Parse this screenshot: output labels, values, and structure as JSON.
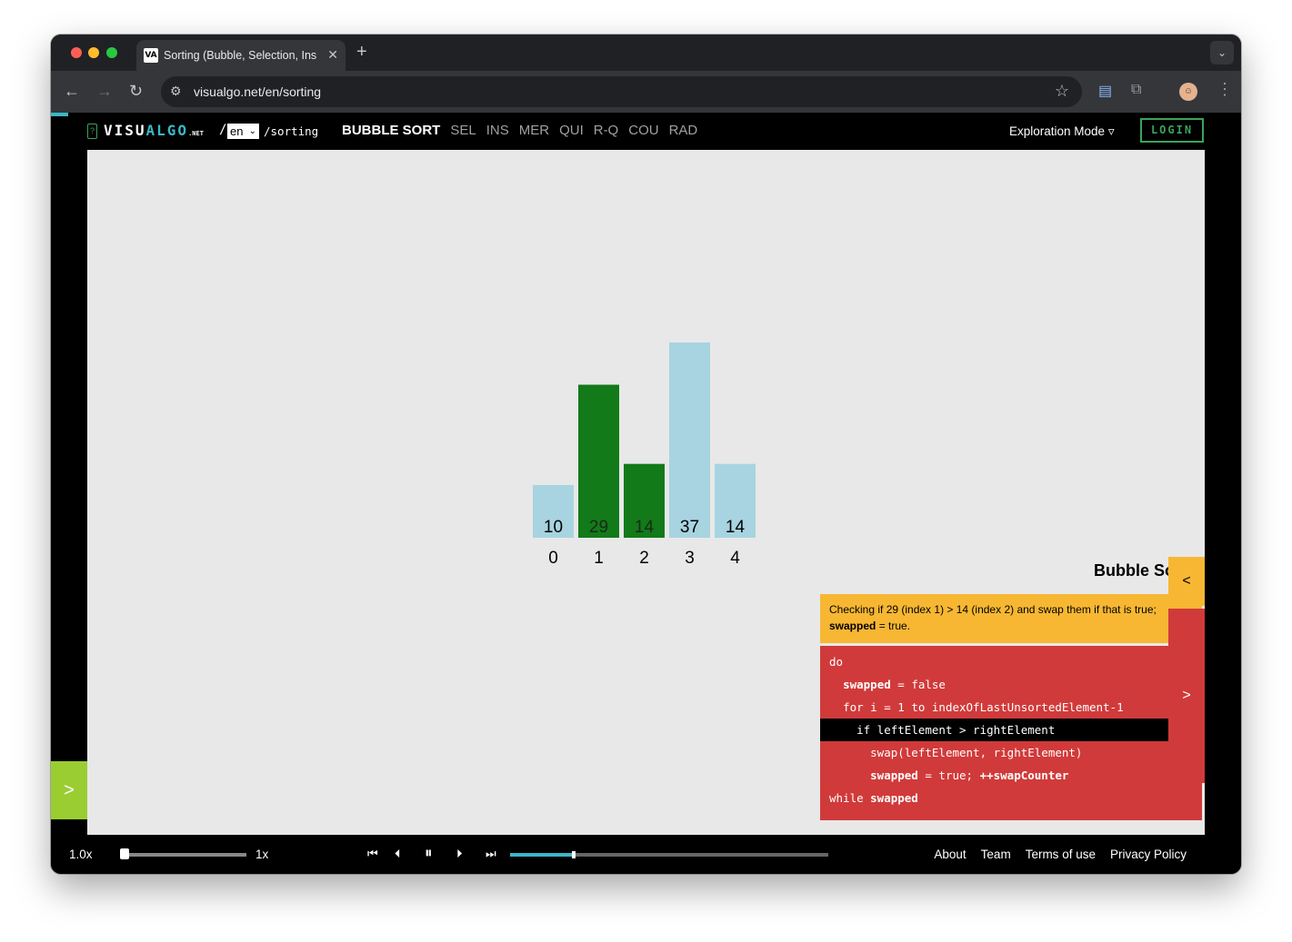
{
  "browser": {
    "tab_title": "Sorting (Bubble, Selection, Insertion, Merge, Quick, Counting, Radix) - VisuAlgo",
    "tab_favicon": "VA",
    "tab_close": "✕",
    "new_tab": "+",
    "tab_list": "⌄",
    "url": "visualgo.net/en/sorting",
    "icons": {
      "back": "←",
      "forward": "→",
      "reload": "↻",
      "site_settings": "⚙",
      "bookmark": "☆",
      "docs": "▤",
      "extensions": "⧉",
      "profile": "☺",
      "menu": "⋮"
    }
  },
  "site": {
    "help": "?",
    "logo": {
      "visu": "VISU",
      "algo": "ALGO",
      "net": ".NET"
    },
    "slash": "/",
    "language": "en",
    "language_caret": "⌄",
    "path": "/sorting",
    "algo_tabs": [
      "BUBBLE SORT",
      "SEL",
      "INS",
      "MER",
      "QUI",
      "R-Q",
      "COU",
      "RAD"
    ],
    "active_tab": "BUBBLE SORT",
    "mode": "Exploration Mode",
    "mode_caret": "▿",
    "login": "LOGIN"
  },
  "chart_data": {
    "type": "bar",
    "categories": [
      "0",
      "1",
      "2",
      "3",
      "4"
    ],
    "values": [
      10,
      29,
      14,
      37,
      14
    ],
    "highlighted_indices": [
      1,
      2
    ],
    "colors": {
      "default": "#a7d4e0",
      "compared": "#127a19"
    },
    "title": "",
    "xlabel": "",
    "ylabel": ""
  },
  "panel": {
    "title": "Bubble Sort",
    "status_pre": "Checking if 29 (index 1) > 14 (index 2) and swap them if that is true; ",
    "status_bold": "swapped",
    "status_post": " = true.",
    "status_toggle": "<",
    "code_toggle": ">",
    "active_line": 3,
    "code": [
      {
        "indent": "",
        "segments": [
          {
            "text": "do",
            "bold": false
          }
        ]
      },
      {
        "indent": "  ",
        "segments": [
          {
            "text": "swapped",
            "bold": true
          },
          {
            "text": " = false",
            "bold": false
          }
        ]
      },
      {
        "indent": "  ",
        "segments": [
          {
            "text": "for i = 1 to indexOfLastUnsortedElement-1",
            "bold": false
          }
        ]
      },
      {
        "indent": "    ",
        "segments": [
          {
            "text": "if leftElement > rightElement",
            "bold": false
          }
        ]
      },
      {
        "indent": "      ",
        "segments": [
          {
            "text": "swap(leftElement, rightElement)",
            "bold": false
          }
        ]
      },
      {
        "indent": "      ",
        "segments": [
          {
            "text": "swapped",
            "bold": true
          },
          {
            "text": " = true; ",
            "bold": false
          },
          {
            "text": "++swapCounter",
            "bold": true
          }
        ]
      },
      {
        "indent": "",
        "segments": [
          {
            "text": "while ",
            "bold": false
          },
          {
            "text": "swapped",
            "bold": true
          }
        ]
      }
    ]
  },
  "left_toggle": ">",
  "controls": {
    "speed_label": "1.0x",
    "speed_right": "1x",
    "speed_fraction": 0.0,
    "progress_fraction": 0.2,
    "icons": {
      "first": "⏮",
      "prev": "⏴",
      "pause": "⏸",
      "next": "⏵",
      "last": "⏭"
    }
  },
  "footer": {
    "links": [
      "About",
      "Team",
      "Terms of use",
      "Privacy Policy"
    ]
  }
}
